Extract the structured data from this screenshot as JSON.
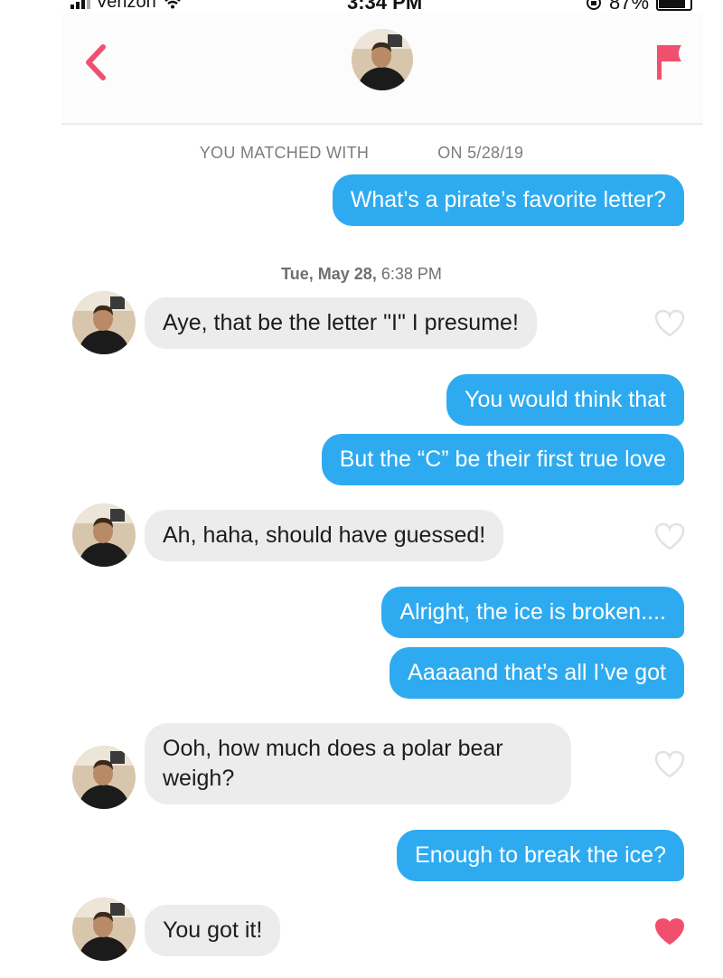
{
  "status_bar": {
    "carrier": "Verizon",
    "time": "3:34 PM",
    "battery": "87%"
  },
  "header": {
    "back_icon": "chevron-left-icon",
    "flag_icon": "flag-icon",
    "accent_color": "#f0506e"
  },
  "match": {
    "prefix": "YOU MATCHED WITH",
    "suffix": "ON 5/28/19"
  },
  "timestamp": {
    "day": "Tue, May 28,",
    "time": "6:38 PM"
  },
  "messages": [
    {
      "direction": "outgoing",
      "text": "What’s a pirate’s favorite letter?"
    },
    {
      "direction": "incoming",
      "text": "Aye, that be the letter \"I\" I presume!",
      "liked": false
    },
    {
      "direction": "outgoing",
      "text": "You would think that"
    },
    {
      "direction": "outgoing",
      "text": "But the “C” be their first true love"
    },
    {
      "direction": "incoming",
      "text": "Ah, haha, should have guessed!",
      "liked": false
    },
    {
      "direction": "outgoing",
      "text": "Alright, the ice is broken...."
    },
    {
      "direction": "outgoing",
      "text": "Aaaaand that’s all I’ve got"
    },
    {
      "direction": "incoming",
      "text": "Ooh, how much does a polar bear\nweigh?",
      "liked": false
    },
    {
      "direction": "outgoing",
      "text": "Enough to break the ice?"
    },
    {
      "direction": "incoming",
      "text": "You got it!",
      "liked": true
    }
  ],
  "colors": {
    "outgoing_bubble": "#2eabf0",
    "incoming_bubble": "#ececec",
    "heart_liked": "#f0506e",
    "heart_unliked": "#e2e2e2"
  }
}
